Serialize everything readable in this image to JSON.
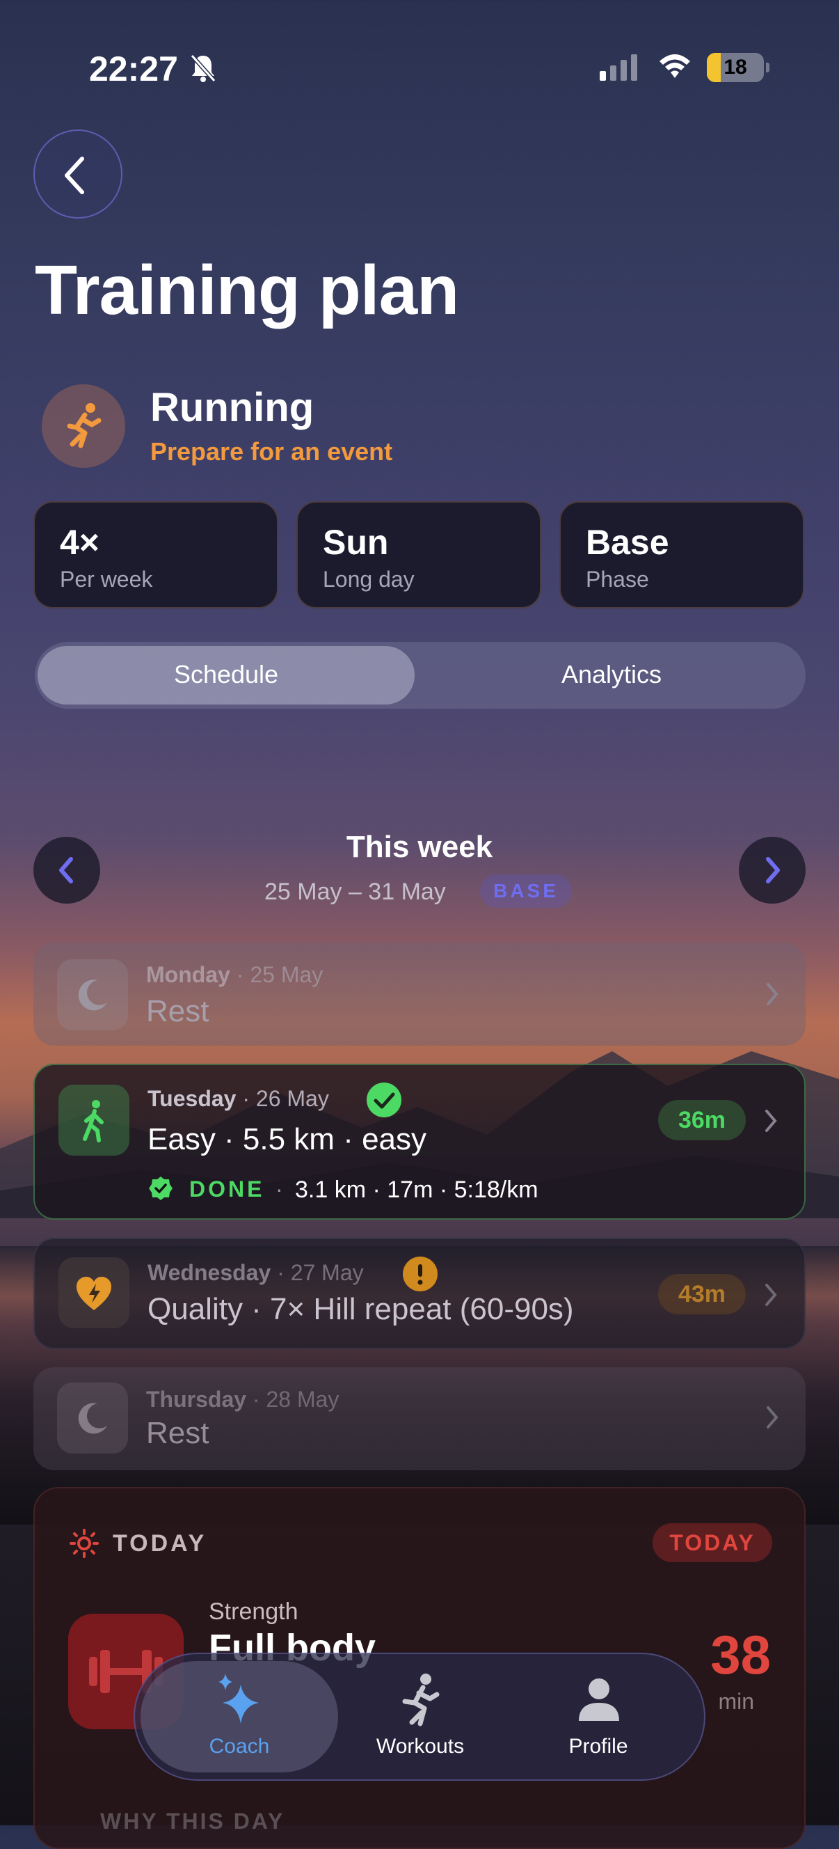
{
  "status": {
    "time": "22:27",
    "battery": "18"
  },
  "page": {
    "title": "Training plan"
  },
  "sport": {
    "name": "Running",
    "goal": "Prepare for an event"
  },
  "stats": [
    {
      "value": "4×",
      "label": "Per week"
    },
    {
      "value": "Sun",
      "label": "Long day"
    },
    {
      "value": "Base",
      "label": "Phase"
    }
  ],
  "tabs": {
    "schedule": "Schedule",
    "analytics": "Analytics",
    "selected": "Schedule"
  },
  "week": {
    "title": "This week",
    "range": "25 May – 31 May",
    "badge": "BASE"
  },
  "days": [
    {
      "day": "Monday",
      "date": "· 25 May",
      "title": "Rest"
    },
    {
      "day": "Tuesday",
      "date": "· 26 May",
      "title": "Easy · 5.5 km · easy",
      "duration": "36m",
      "done_label": "DONE",
      "done_stats": "3.1 km · 17m · 5:18/km"
    },
    {
      "day": "Wednesday",
      "date": "· 27 May",
      "title": "Quality · 7× Hill repeat (60-90s)",
      "duration": "43m"
    },
    {
      "day": "Thursday",
      "date": "· 28 May",
      "title": "Rest"
    }
  ],
  "today": {
    "header": "TODAY",
    "badge": "TODAY",
    "category": "Strength",
    "title": "Full body",
    "minutes": "38",
    "unit": "min",
    "footer": "WHY THIS DAY"
  },
  "nav": {
    "coach": "Coach",
    "workouts": "Workouts",
    "profile": "Profile",
    "active": "Coach"
  },
  "colors": {
    "accent_orange": "#f39a3e",
    "done_green": "#4cd964",
    "today_red": "#e0463e",
    "week_accent": "#6f6df0"
  }
}
